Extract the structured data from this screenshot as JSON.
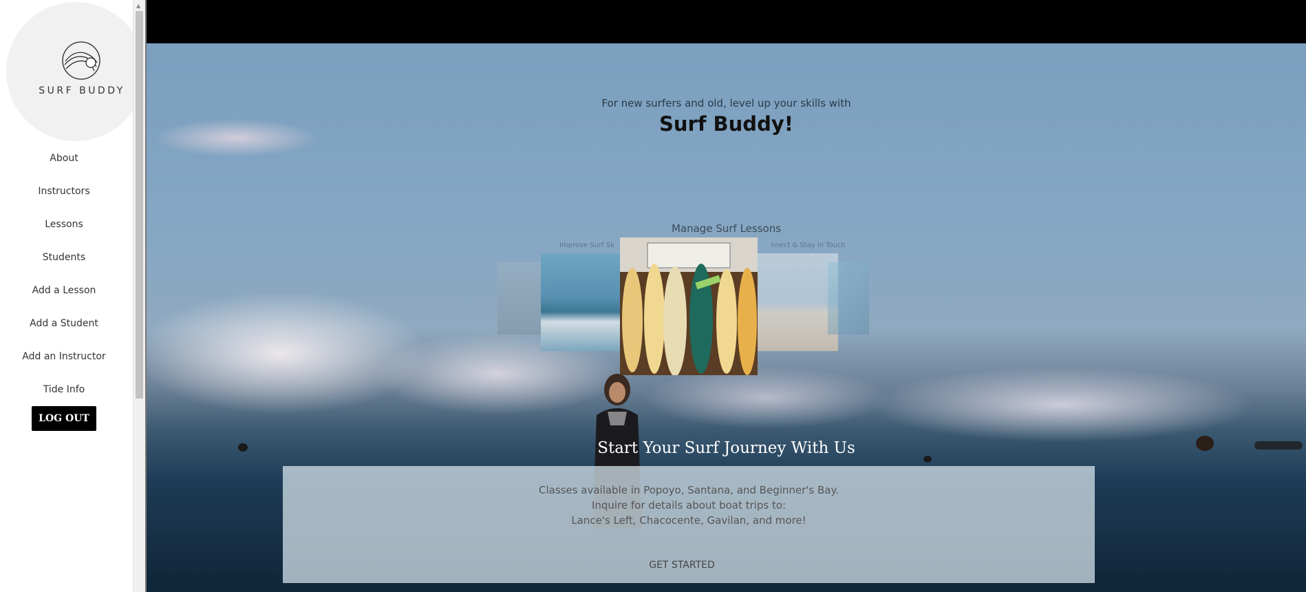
{
  "brand": {
    "logo_icon": "wave-circle-logo-icon",
    "name": "SURF BUDDY"
  },
  "nav": {
    "items": [
      {
        "label": "About"
      },
      {
        "label": "Instructors"
      },
      {
        "label": "Lessons"
      },
      {
        "label": "Students"
      },
      {
        "label": "Add a Lesson"
      },
      {
        "label": "Add a Student"
      },
      {
        "label": "Add an Instructor"
      },
      {
        "label": "Tide Info"
      }
    ],
    "logout_label": "LOG OUT"
  },
  "hero": {
    "tagline": "For new surfers and old, level up your skills with",
    "title": "Surf Buddy!"
  },
  "carousel": {
    "title": "Manage Surf Lessons",
    "caption_left": "Improve Surf Sk",
    "caption_right": "nnect & Stay in Touch"
  },
  "journey": {
    "title": "Start Your Surf Journey With Us",
    "line1": "Classes available in Popoyo, Santana, and Beginner's Bay.",
    "line2": "Inquire for details about boat trips to:",
    "line3": "Lance's Left, Chacocente, Gavilan, and more!",
    "button_label": "GET STARTED"
  },
  "colors": {
    "sidebar_bg": "#ffffff",
    "logout_bg": "#000000",
    "topbar": "#000000"
  }
}
